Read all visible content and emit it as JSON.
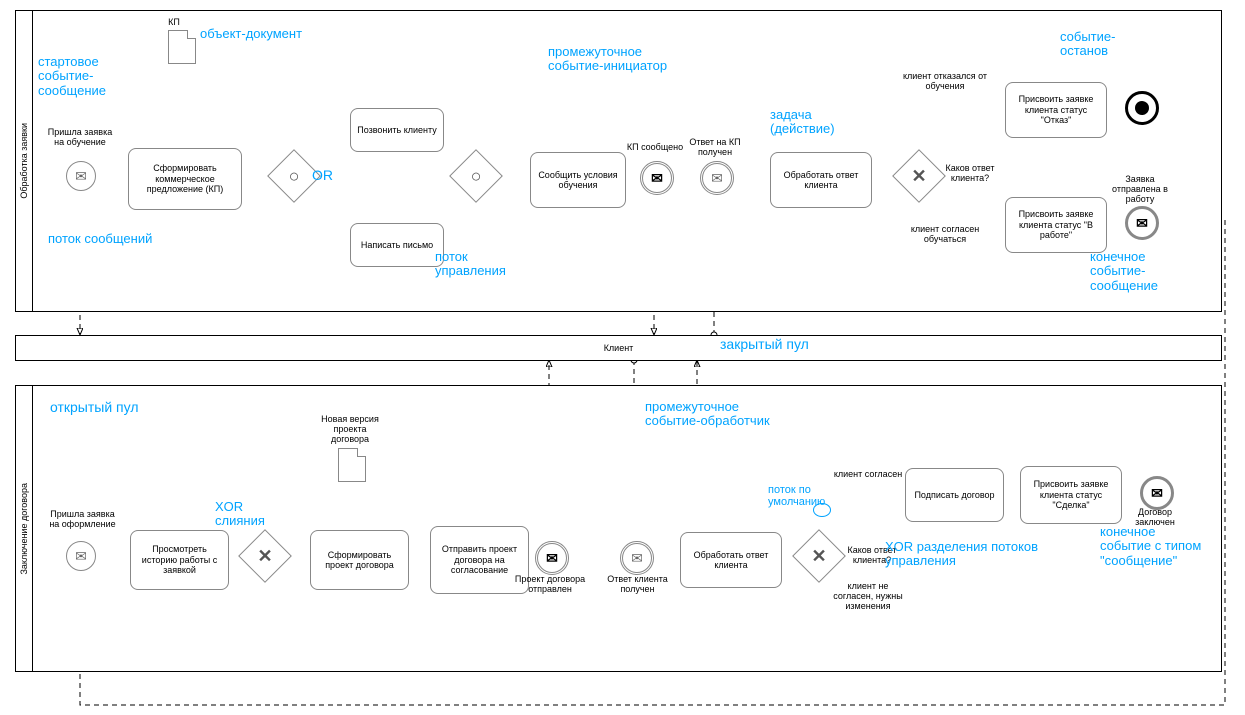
{
  "pools": {
    "p1": {
      "title": "Обработка заявки"
    },
    "p2": {
      "title": "Заключение договора"
    },
    "closed": {
      "title": "Клиент"
    }
  },
  "annotations": {
    "startMsg": "стартовое событие-сообщение",
    "dataObj": "объект-документ",
    "msgFlow": "поток сообщений",
    "or": "OR",
    "ctrlFlow": "поток управления",
    "interThrow": "промежуточное событие-инициатор",
    "taskAct": "задача (действие)",
    "endTerm": "событие-останов",
    "endMsg": "конечное событие-сообщение",
    "closedPool": "закрытый пул",
    "openPool": "открытый пул",
    "xorMerge": "XOR слияния",
    "interCatch": "промежуточное событие-обработчик",
    "defaultFlow": "поток по умолчанию",
    "xorSplit": "XOR разделения потоков управления",
    "endMsg2": "конечное событие с типом \"сообщение\""
  },
  "p1": {
    "startLabel": "Пришла заявка на обучение",
    "kp": "КП",
    "t1": "Сформировать коммерческое предложение (КП)",
    "t2": "Позвонить клиенту",
    "t3": "Написать письмо",
    "t4": "Сообщить условия обучения",
    "e1": "КП сообщено",
    "e2": "Ответ на КП получен",
    "t5": "Обработать ответ клиента",
    "gwQ": "Каков ответ клиента?",
    "c1": "клиент отказался от обучения",
    "c2": "клиент согласен обучаться",
    "t6": "Присвоить заявке клиента статус \"Отказ\"",
    "t7": "Присвоить заявке клиента статус \"В работе\"",
    "endMsgLabel": "Заявка отправлена в работу"
  },
  "p2": {
    "startLabel": "Пришла заявка на оформление",
    "t1": "Просмотреть историю работы с заявкой",
    "docLabel": "Новая версия проекта договора",
    "t2": "Сформировать проект договора",
    "t3": "Отправить проект договора на согласование",
    "e1": "Проект договора отправлен",
    "e2": "Ответ клиента получен",
    "t4": "Обработать ответ клиента",
    "gwQ": "Каков ответ клиента?",
    "c1": "клиент согласен",
    "c2": "клиент не согласен, нужны изменения",
    "t5": "Подписать договор",
    "t6": "Присвоить заявке клиента статус \"Сделка\"",
    "endLabel": "Договор заключен"
  }
}
